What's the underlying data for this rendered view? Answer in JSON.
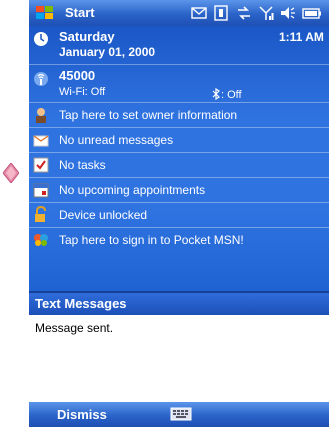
{
  "taskbar": {
    "start_label": "Start"
  },
  "today": {
    "date": {
      "day": "Saturday",
      "date": "January 01, 2000",
      "time": "1:11 AM"
    },
    "phone": {
      "number": "45000",
      "wifi": "Wi-Fi: Off",
      "bluetooth": ": Off"
    },
    "items": [
      {
        "label": "Tap here to set owner information",
        "icon": "owner-icon"
      },
      {
        "label": "No unread messages",
        "icon": "envelope-icon"
      },
      {
        "label": "No tasks",
        "icon": "tasks-icon"
      },
      {
        "label": "No upcoming appointments",
        "icon": "calendar-icon"
      },
      {
        "label": "Device unlocked",
        "icon": "lock-icon"
      },
      {
        "label": "Tap here to sign in to Pocket MSN!",
        "icon": "msn-icon"
      }
    ]
  },
  "popup": {
    "title": "Text Messages",
    "message": "Message sent."
  },
  "menubar": {
    "dismiss_label": "Dismiss"
  }
}
